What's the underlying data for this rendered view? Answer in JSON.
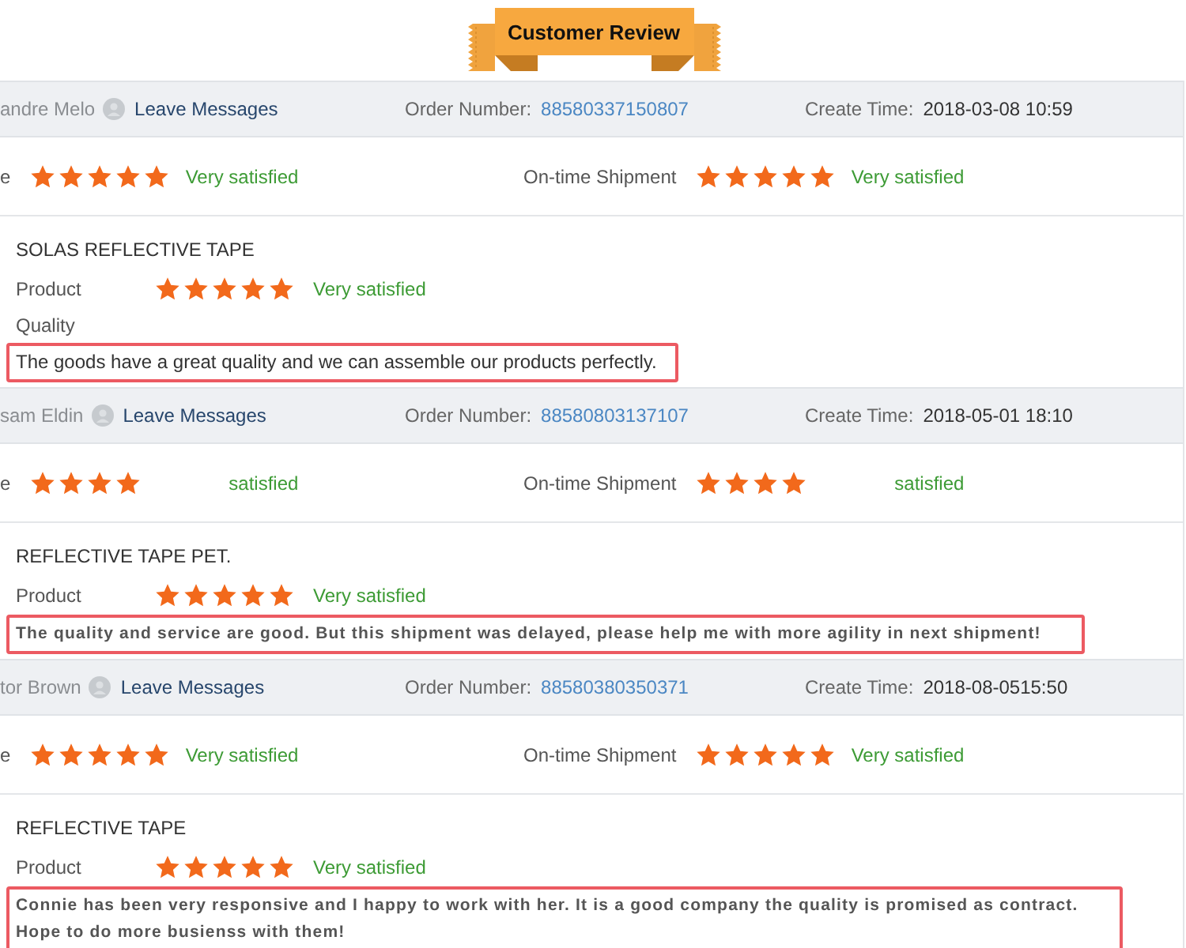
{
  "banner": {
    "title": "Customer Review"
  },
  "reviews": [
    {
      "buyer": "andre Melo",
      "message_link": "Leave Messages",
      "order_label": "Order Number:",
      "order_number": "88580337150807",
      "time_label": "Create Time:",
      "create_time": "2018-03-08 10:59",
      "ratings": [
        {
          "label": "e",
          "stars": 5,
          "verdict": "Very satisfied"
        },
        {
          "label": "On-time Shipment",
          "stars": 5,
          "verdict": "Very satisfied"
        }
      ],
      "product": {
        "name": "SOLAS REFLECTIVE TAPE",
        "rows": [
          {
            "kind": "rated",
            "label": "Product",
            "stars": 5,
            "verdict": "Very satisfied"
          },
          {
            "kind": "unrated",
            "label": "Quality"
          }
        ]
      },
      "comment": {
        "kind": "plain",
        "text": "The goods have a great quality and we can assemble our products perfectly."
      }
    },
    {
      "buyer": "sam Eldin",
      "message_link": "Leave Messages",
      "order_label": "Order Number:",
      "order_number": "88580803137107",
      "time_label": "Create Time:",
      "create_time": "2018-05-01 18:10",
      "ratings": [
        {
          "label": "e",
          "stars": 4,
          "verdict": "satisfied"
        },
        {
          "label": "On-time Shipment",
          "stars": 4,
          "verdict": "satisfied"
        }
      ],
      "product": {
        "name": "REFLECTIVE TAPE PET.",
        "rows": [
          {
            "kind": "rated",
            "label": "Product",
            "stars": 5,
            "verdict": "Very satisfied"
          }
        ]
      },
      "comment": {
        "kind": "bold",
        "text": "The quality and service are good. But this shipment was delayed, please help me with more agility in next shipment!"
      }
    },
    {
      "buyer": "tor Brown",
      "message_link": "Leave Messages",
      "order_label": "Order Number:",
      "order_number": "88580380350371",
      "time_label": "Create Time:",
      "create_time": "2018-08-0515:50",
      "ratings": [
        {
          "label": "e",
          "stars": 5,
          "verdict": "Very satisfied"
        },
        {
          "label": "On-time Shipment",
          "stars": 5,
          "verdict": "Very satisfied"
        }
      ],
      "product": {
        "name": "REFLECTIVE TAPE",
        "rows": [
          {
            "kind": "rated",
            "label": "Product",
            "stars": 5,
            "verdict": "Very satisfied"
          }
        ]
      },
      "comment": {
        "kind": "bold",
        "text": "Connie has been very responsive and I happy to work with her. It is a good company the quality is promised as contract.\nHope to do more busienss with them!"
      }
    }
  ]
}
